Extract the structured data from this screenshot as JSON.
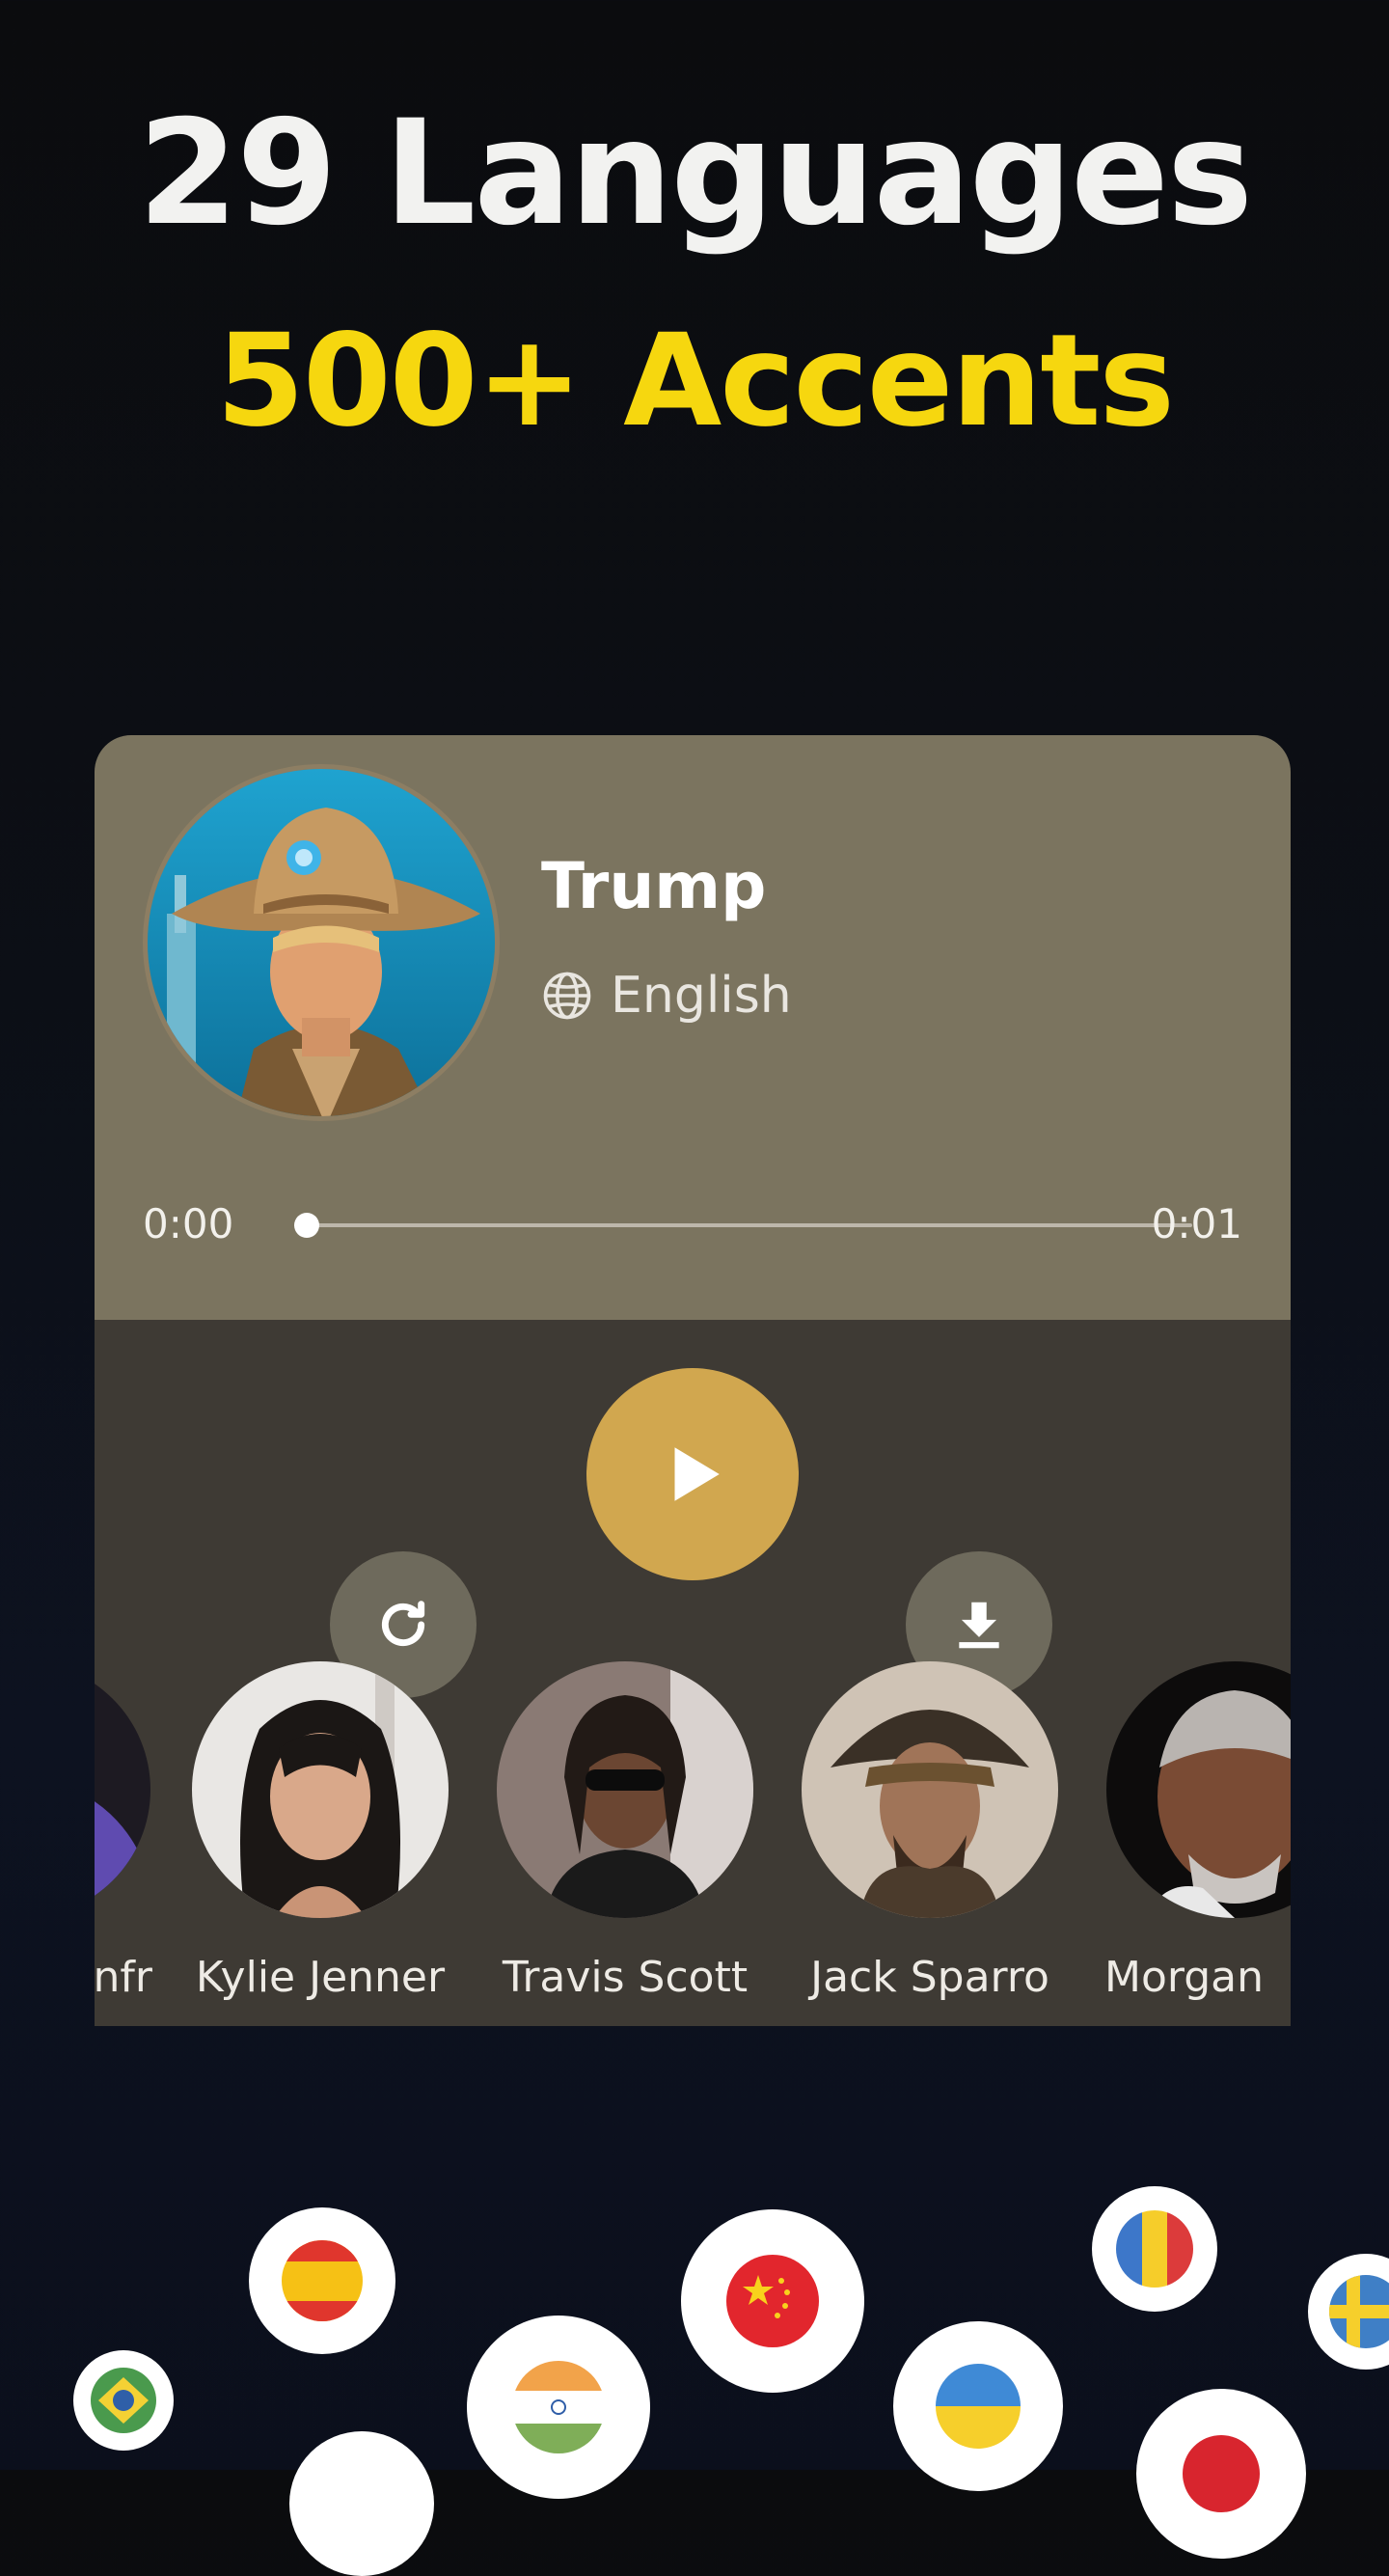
{
  "headline": {
    "line1": "29 Languages",
    "line2": "500+ Accents",
    "line1_color": "#f2f2f0",
    "line2_color": "#f6d70f"
  },
  "player": {
    "voice_name": "Trump",
    "language": "English",
    "time_current": "0:00",
    "time_total": "0:01",
    "progress": 0,
    "colors": {
      "top_panel": "#7b745f",
      "bottom_panel": "#3e3a34",
      "play_button": "#d1a74f",
      "secondary_button": "#6e6a5c"
    },
    "icons": {
      "language": "globe-icon",
      "replay": "refresh-icon",
      "play": "play-icon",
      "download": "download-icon"
    }
  },
  "voices": [
    {
      "name": "Infr"
    },
    {
      "name": "Kylie Jenner"
    },
    {
      "name": "Travis Scott"
    },
    {
      "name": "Jack Sparro"
    },
    {
      "name": "Morgan"
    }
  ],
  "flags": [
    {
      "name": "spain-flag"
    },
    {
      "name": "china-flag"
    },
    {
      "name": "romania-flag"
    },
    {
      "name": "sweden-flag"
    },
    {
      "name": "brazil-flag"
    },
    {
      "name": "india-flag"
    },
    {
      "name": "ukraine-flag"
    },
    {
      "name": "japan-flag"
    },
    {
      "name": "unknown-flag"
    }
  ]
}
